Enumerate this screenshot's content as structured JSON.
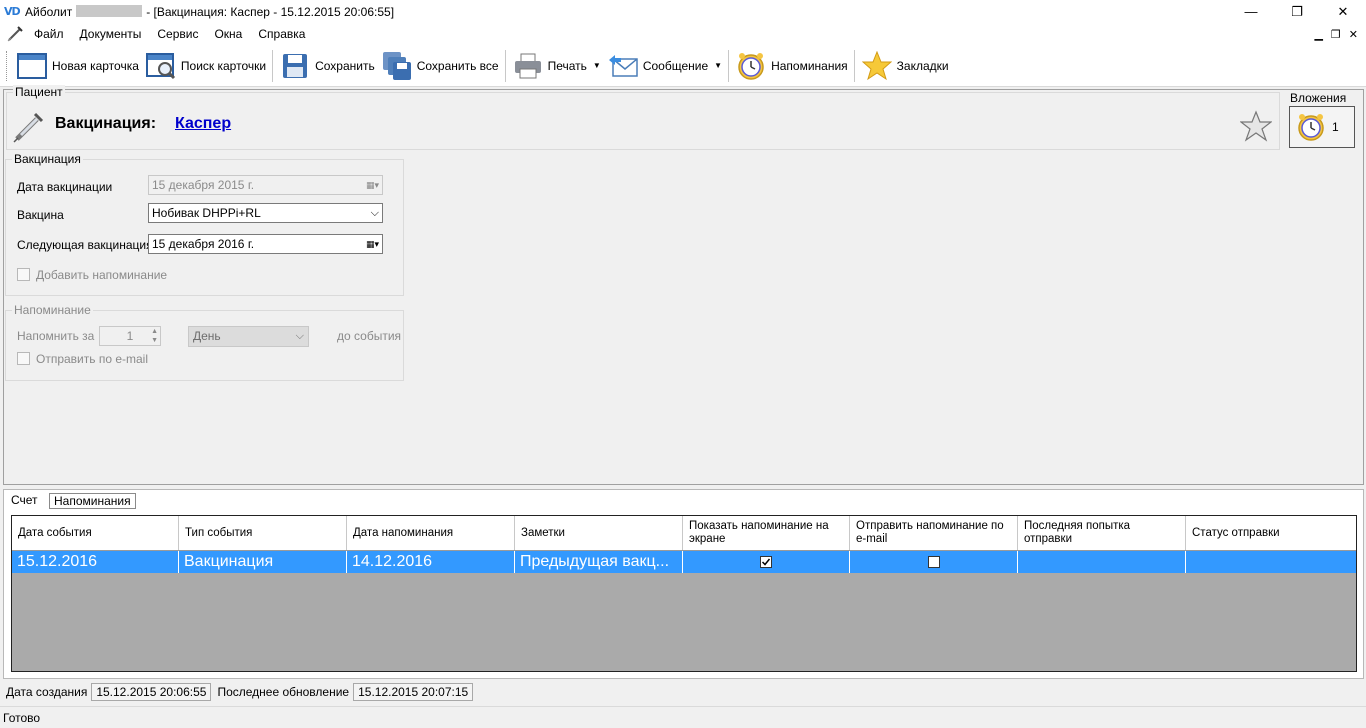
{
  "window": {
    "logo": "VD",
    "app_name": "Айболит",
    "title_rest": "- [Вакцинация: Каспер - 15.12.2015 20:06:55]",
    "minimize": "—",
    "maximize": "❐",
    "close": "✕"
  },
  "menu": {
    "items": [
      "Файл",
      "Документы",
      "Сервис",
      "Окна",
      "Справка"
    ],
    "mdi_minimize": "▁",
    "mdi_restore": "❐",
    "mdi_close": "✕"
  },
  "toolbar": {
    "new_card": "Новая карточка",
    "search_card": "Поиск карточки",
    "save": "Сохранить",
    "save_all": "Сохранить все",
    "print": "Печать",
    "message": "Сообщение",
    "reminders": "Напоминания",
    "bookmarks": "Закладки"
  },
  "patient": {
    "group_label": "Пациент",
    "title": "Вакцинация:",
    "name": "Каспер",
    "attachments_label": "Вложения",
    "attachments_count": "1"
  },
  "vaccination": {
    "group_label": "Вакцинация",
    "date_label": "Дата вакцинации",
    "date_value": "15 декабря  2015 г.",
    "vaccine_label": "Вакцина",
    "vaccine_value": "Нобивак DHPPi+RL",
    "next_label": "Следующая вакцинация",
    "next_value": "15 декабря  2016 г.",
    "add_reminder_label": "Добавить напоминание"
  },
  "reminder": {
    "group_label": "Напоминание",
    "remind_label": "Напомнить за",
    "remind_value": "1",
    "unit_value": "День",
    "before_label": "до события",
    "email_label": "Отправить по e-mail"
  },
  "tabs": [
    "Счет",
    "Напоминания"
  ],
  "grid": {
    "columns": [
      "Дата события",
      "Тип события",
      "Дата напоминания",
      "Заметки",
      "Показать напоминание на экране",
      "Отправить напоминание по e-mail",
      "Последняя попытка отправки",
      "Статус отправки"
    ],
    "rows": [
      {
        "event_date": "15.12.2016",
        "event_type": "Вакцинация",
        "reminder_date": "14.12.2016",
        "notes": "Предыдущая вакц...",
        "show_on_screen": true,
        "send_email": false,
        "last_attempt": "",
        "send_status": ""
      }
    ]
  },
  "info": {
    "created_label": "Дата создания",
    "created_value": "15.12.2015 20:06:55",
    "updated_label": "Последнее обновление",
    "updated_value": "15.12.2015 20:07:15"
  },
  "status": "Готово"
}
